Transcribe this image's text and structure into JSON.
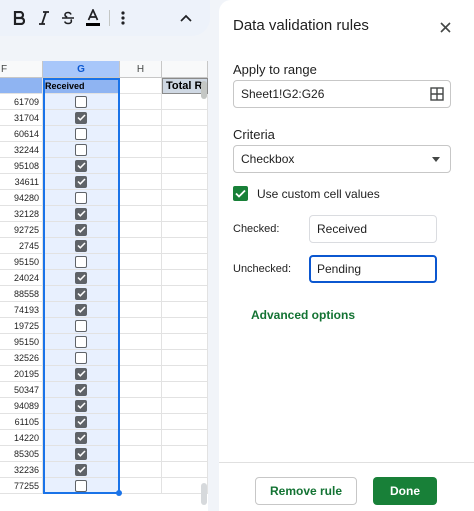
{
  "toolbar": {
    "items": [
      {
        "icon": "bold-icon"
      },
      {
        "icon": "italic-icon"
      },
      {
        "icon": "strikethrough-icon"
      },
      {
        "icon": "text-color-icon"
      },
      {
        "icon": "more-vert-icon"
      },
      {
        "icon": "chevron-up-icon"
      }
    ],
    "text_color": "#000000"
  },
  "sheet": {
    "columns": [
      "F",
      "G",
      "H"
    ],
    "selected_column": "G",
    "header_cell_g": "Received",
    "total_label": "Total R",
    "rows": [
      {
        "f": "61709",
        "checked": false
      },
      {
        "f": "31704",
        "checked": true
      },
      {
        "f": "60614",
        "checked": false
      },
      {
        "f": "32244",
        "checked": false
      },
      {
        "f": "95108",
        "checked": true
      },
      {
        "f": "34611",
        "checked": true
      },
      {
        "f": "94280",
        "checked": false
      },
      {
        "f": "32128",
        "checked": true
      },
      {
        "f": "92725",
        "checked": true
      },
      {
        "f": "2745",
        "checked": true
      },
      {
        "f": "95150",
        "checked": false
      },
      {
        "f": "24024",
        "checked": true
      },
      {
        "f": "88558",
        "checked": true
      },
      {
        "f": "74193",
        "checked": true
      },
      {
        "f": "19725",
        "checked": false
      },
      {
        "f": "95150",
        "checked": false
      },
      {
        "f": "32526",
        "checked": false
      },
      {
        "f": "20195",
        "checked": true
      },
      {
        "f": "50347",
        "checked": true
      },
      {
        "f": "94089",
        "checked": true
      },
      {
        "f": "61105",
        "checked": true
      },
      {
        "f": "14220",
        "checked": true
      },
      {
        "f": "85305",
        "checked": true
      },
      {
        "f": "32236",
        "checked": true
      },
      {
        "f": "77255",
        "checked": false
      }
    ]
  },
  "panel": {
    "title": "Data validation rules",
    "apply_label": "Apply to range",
    "range_value": "Sheet1!G2:G26",
    "criteria_label": "Criteria",
    "criteria_value": "Checkbox",
    "custom_values_label": "Use custom cell values",
    "custom_values_checked": true,
    "checked_label": "Checked:",
    "checked_value": "Received",
    "unchecked_label": "Unchecked:",
    "unchecked_value": "Pending",
    "advanced_label": "Advanced options",
    "remove_label": "Remove rule",
    "done_label": "Done"
  },
  "colors": {
    "accent_green": "#188038",
    "link_green": "#137333",
    "focus_blue": "#0b57d0",
    "selection_blue": "#1a73e8"
  }
}
